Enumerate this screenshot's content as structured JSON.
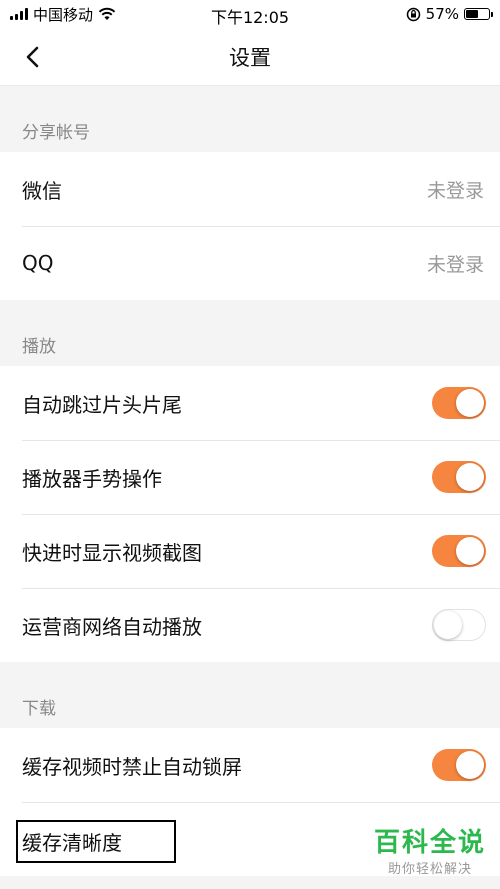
{
  "status_bar": {
    "carrier": "中国移动",
    "time": "下午12:05",
    "battery_percent": "57%",
    "battery_level": 0.57
  },
  "nav": {
    "title": "设置"
  },
  "sections": [
    {
      "header": "分享帐号",
      "rows": [
        {
          "label": "微信",
          "value": "未登录"
        },
        {
          "label": "QQ",
          "value": "未登录"
        }
      ]
    },
    {
      "header": "播放",
      "rows": [
        {
          "label": "自动跳过片头片尾",
          "toggle": true
        },
        {
          "label": "播放器手势操作",
          "toggle": true
        },
        {
          "label": "快进时显示视频截图",
          "toggle": true
        },
        {
          "label": "运营商网络自动播放",
          "toggle": false
        }
      ]
    },
    {
      "header": "下载",
      "rows": [
        {
          "label": "缓存视频时禁止自动锁屏",
          "toggle": true
        },
        {
          "label": "缓存清晰度"
        }
      ]
    }
  ],
  "watermark": {
    "title": "百科全说",
    "subtitle": "助你轻松解决"
  },
  "colors": {
    "toggle_on": "#f5853f",
    "watermark": "#2db84d"
  }
}
